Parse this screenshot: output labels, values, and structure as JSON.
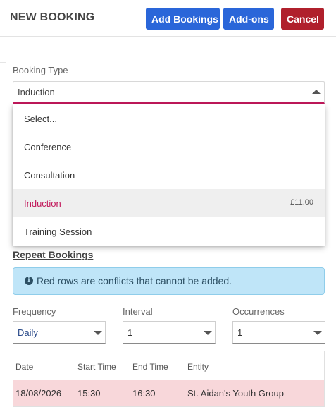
{
  "header": {
    "title": "NEW BOOKING",
    "add_bookings": "Add Bookings",
    "add_ons": "Add-ons",
    "cancel": "Cancel"
  },
  "booking_type": {
    "label": "Booking Type",
    "value": "Induction",
    "options": [
      {
        "label": "Select...",
        "price": ""
      },
      {
        "label": "Conference",
        "price": ""
      },
      {
        "label": "Consultation",
        "price": ""
      },
      {
        "label": "Induction",
        "price": "£11.00",
        "selected": true
      },
      {
        "label": "Training Session",
        "price": ""
      }
    ]
  },
  "repeat": {
    "title": "Repeat Bookings",
    "alert": "Red rows are conflicts that cannot be added.",
    "frequency": {
      "label": "Frequency",
      "value": "Daily"
    },
    "interval": {
      "label": "Interval",
      "value": "1"
    },
    "occurrences": {
      "label": "Occurrences",
      "value": "1"
    }
  },
  "table": {
    "columns": [
      "Date",
      "Start Time",
      "End Time",
      "Entity"
    ],
    "rows": [
      {
        "date": "18/08/2026",
        "start": "15:30",
        "end": "16:30",
        "entity": "St. Aidan's Youth Group",
        "conflict": true
      }
    ]
  },
  "colors": {
    "primary": "#2a66d9",
    "danger": "#b0202c",
    "accent": "#c2185b",
    "info_bg": "#bfe5f8",
    "conflict_row": "#f8d7da"
  },
  "icons": {
    "info": "info-circle-icon",
    "dropdown_open": "caret-up-icon",
    "dropdown_closed": "caret-down-icon"
  }
}
